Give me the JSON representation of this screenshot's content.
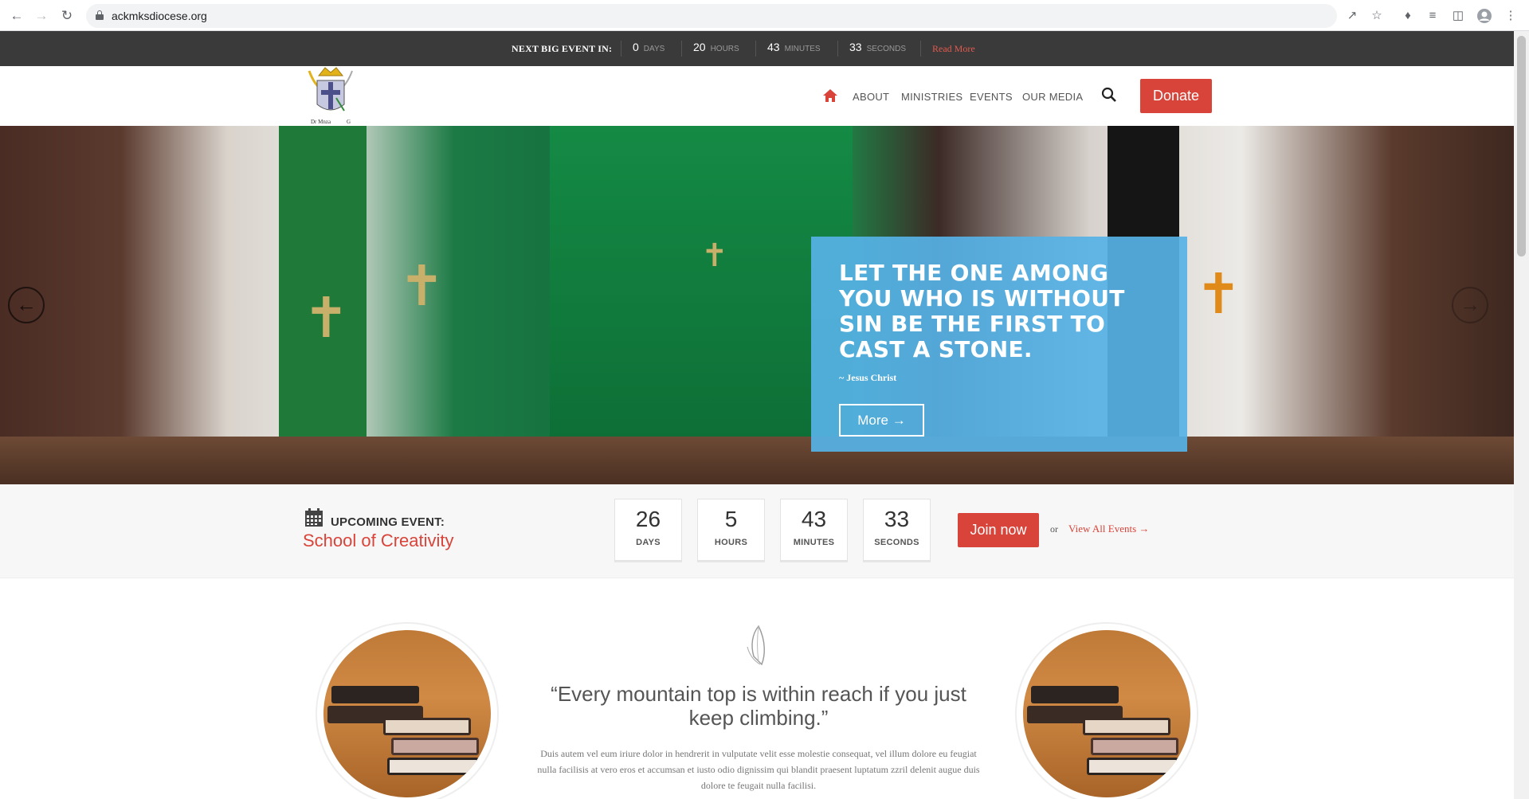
{
  "browser": {
    "url": "ackmksdiocese.org"
  },
  "event_bar": {
    "label": "NEXT BIG EVENT IN:",
    "countdown": [
      {
        "num": "0",
        "unit": "DAYS"
      },
      {
        "num": "20",
        "unit": "HOURS"
      },
      {
        "num": "43",
        "unit": "MINUTES"
      },
      {
        "num": "33",
        "unit": "SECONDS"
      }
    ],
    "read_more": "Read More"
  },
  "nav": {
    "items": [
      "ABOUT",
      "MINISTRIES",
      "EVENTS",
      "OUR MEDIA"
    ],
    "donate": "Donate"
  },
  "hero": {
    "quote": "LET THE ONE AMONG YOU WHO IS WITHOUT SIN BE THE FIRST TO CAST A STONE.",
    "author": "~ Jesus Christ",
    "more": "More →"
  },
  "upcoming": {
    "label": "UPCOMING EVENT:",
    "title": "School of Creativity",
    "countdown": [
      {
        "num": "26",
        "unit": "DAYS"
      },
      {
        "num": "5",
        "unit": "HOURS"
      },
      {
        "num": "43",
        "unit": "MINUTES"
      },
      {
        "num": "33",
        "unit": "SECONDS"
      }
    ],
    "join": "Join now",
    "or": "or",
    "view_all": "View All Events →"
  },
  "lower": {
    "quote": "“Every mountain top is within reach if you just keep climbing.”",
    "body": "Duis autem vel eum iriure dolor in hendrerit in vulputate velit esse molestie consequat, vel illum dolore eu feugiat nulla facilisis at vero eros et accumsan et iusto odio dignissim qui blandit praesent luptatum zzril delenit augue duis dolore te feugait nulla facilisi."
  },
  "colors": {
    "accent": "#d9443a",
    "quote_box": "#56b2e6",
    "event_bar": "#3a3a3a"
  }
}
